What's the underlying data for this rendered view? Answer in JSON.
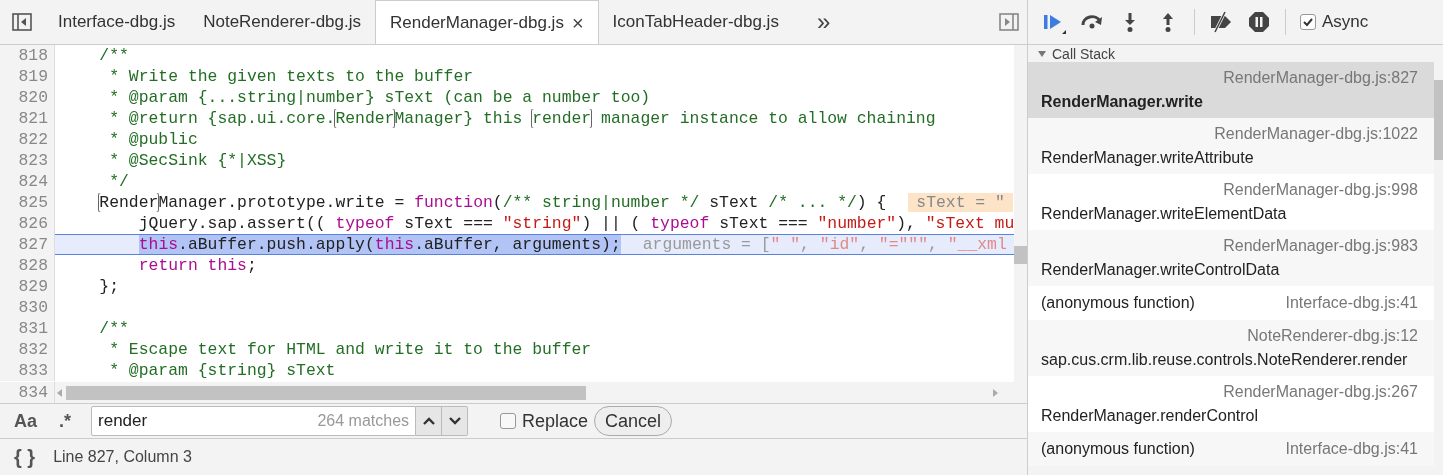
{
  "editor": {
    "tabs": [
      {
        "label": "Interface-dbg.js",
        "selected": false
      },
      {
        "label": "NoteRenderer-dbg.js",
        "selected": false
      },
      {
        "label": "RenderManager-dbg.js",
        "selected": true,
        "close_glyph": "×"
      },
      {
        "label": "IconTabHeader-dbg.js",
        "selected": false
      }
    ],
    "more_tabs_glyph": "»",
    "lines": [
      {
        "number": "818",
        "current": false,
        "tokens": [
          {
            "kind": "comment",
            "text": "    /**"
          }
        ]
      },
      {
        "number": "819",
        "current": false,
        "tokens": [
          {
            "kind": "comment",
            "text": "     * Write the given texts to the buffer"
          }
        ]
      },
      {
        "number": "820",
        "current": false,
        "tokens": [
          {
            "kind": "comment",
            "text": "     * @param {...string|number} sText (can be a number too)"
          }
        ]
      },
      {
        "number": "821",
        "current": false,
        "tokens": [
          {
            "kind": "comment",
            "text": "     * @return {sap.ui.core."
          },
          {
            "kind": "comment",
            "text": "Render",
            "match": true
          },
          {
            "kind": "comment",
            "text": "Manager} this "
          },
          {
            "kind": "comment",
            "text": "render",
            "match": true
          },
          {
            "kind": "comment",
            "text": " manager instance to allow chaining"
          }
        ]
      },
      {
        "number": "822",
        "current": false,
        "tokens": [
          {
            "kind": "comment",
            "text": "     * @public"
          }
        ]
      },
      {
        "number": "823",
        "current": false,
        "tokens": [
          {
            "kind": "comment",
            "text": "     * @SecSink {*|XSS}"
          }
        ]
      },
      {
        "number": "824",
        "current": false,
        "tokens": [
          {
            "kind": "comment",
            "text": "     */"
          }
        ]
      },
      {
        "number": "825",
        "current": false,
        "tokens": [
          {
            "kind": "plain",
            "text": "    Render",
            "match": true
          },
          {
            "kind": "plain",
            "text": "Manager.prototype.write = "
          },
          {
            "kind": "keyword",
            "text": "function"
          },
          {
            "kind": "plain",
            "text": "("
          },
          {
            "kind": "comment",
            "text": "/** string|number */"
          },
          {
            "kind": "plain",
            "text": " sText "
          },
          {
            "kind": "comment",
            "text": "/* ... */"
          },
          {
            "kind": "plain",
            "text": ") {"
          },
          {
            "kind": "value",
            "text": "sText = \""
          }
        ]
      },
      {
        "number": "826",
        "current": false,
        "tokens": [
          {
            "kind": "plain",
            "text": "        jQuery.sap.assert(( "
          },
          {
            "kind": "keyword",
            "text": "typeof"
          },
          {
            "kind": "plain",
            "text": " sText === "
          },
          {
            "kind": "string",
            "text": "\"string\""
          },
          {
            "kind": "plain",
            "text": ") || ( "
          },
          {
            "kind": "keyword",
            "text": "typeof"
          },
          {
            "kind": "plain",
            "text": " sText === "
          },
          {
            "kind": "string",
            "text": "\"number\""
          },
          {
            "kind": "plain",
            "text": "), "
          },
          {
            "kind": "string",
            "text": "\"sText mu"
          }
        ]
      },
      {
        "number": "827",
        "current": true,
        "tokens": [
          {
            "kind": "keyword",
            "text": "        this"
          },
          {
            "kind": "plain",
            "text": ".aBuffer.push.apply("
          },
          {
            "kind": "keyword",
            "text": "this"
          },
          {
            "kind": "plain",
            "text": ".aBuffer, arguments);"
          },
          {
            "kind": "hint",
            "text": "arguments = ["
          },
          {
            "kind": "hint-string",
            "text": "\" \""
          },
          {
            "kind": "hint",
            "text": ", "
          },
          {
            "kind": "hint-string",
            "text": "\"id\""
          },
          {
            "kind": "hint",
            "text": ", "
          },
          {
            "kind": "hint-string",
            "text": "\"=\"\"\""
          },
          {
            "kind": "hint",
            "text": ", "
          },
          {
            "kind": "hint-string",
            "text": "\"__xml"
          }
        ]
      },
      {
        "number": "828",
        "current": false,
        "tokens": [
          {
            "kind": "keyword",
            "text": "        return this"
          },
          {
            "kind": "plain",
            "text": ";"
          }
        ]
      },
      {
        "number": "829",
        "current": false,
        "tokens": [
          {
            "kind": "plain",
            "text": "    };"
          }
        ]
      },
      {
        "number": "830",
        "current": false
      },
      {
        "number": "831",
        "current": false,
        "tokens": [
          {
            "kind": "comment",
            "text": "    /**"
          }
        ]
      },
      {
        "number": "832",
        "current": false,
        "tokens": [
          {
            "kind": "comment",
            "text": "     * Escape text for HTML and write it to the buffer"
          }
        ]
      },
      {
        "number": "833",
        "current": false,
        "tokens": [
          {
            "kind": "comment",
            "text": "     * @param {string} sText"
          }
        ]
      },
      {
        "number": "834",
        "current": false
      }
    ],
    "find_bar": {
      "case_toggle": "Aa",
      "regex_toggle": ".*",
      "query": "render",
      "match_count": "264 matches",
      "replace": {
        "label": "Replace",
        "checked": false
      },
      "cancel": "Cancel"
    },
    "status_bar": {
      "format_button": "{ }",
      "position": "Line 827, Column 3"
    }
  },
  "debugger": {
    "async": {
      "label": "Async",
      "checked": true
    },
    "call_stack": {
      "title": "Call Stack",
      "frames": [
        {
          "kind": "stacked",
          "function": "RenderManager.write",
          "location": "RenderManager-dbg.js:827",
          "selected": true
        },
        {
          "kind": "stacked",
          "function": "RenderManager.writeAttribute",
          "location": "RenderManager-dbg.js:1022",
          "selected": false
        },
        {
          "kind": "stacked",
          "function": "RenderManager.writeElementData",
          "location": "RenderManager-dbg.js:998",
          "selected": false
        },
        {
          "kind": "stacked",
          "function": "RenderManager.writeControlData",
          "location": "RenderManager-dbg.js:983",
          "selected": false
        },
        {
          "kind": "inline",
          "function": "(anonymous function)",
          "location": "Interface-dbg.js:41",
          "selected": false
        },
        {
          "kind": "stacked",
          "function": "sap.cus.crm.lib.reuse.controls.NoteRenderer.render",
          "location": "NoteRenderer-dbg.js:12",
          "selected": false
        },
        {
          "kind": "stacked",
          "function": "RenderManager.renderControl",
          "location": "RenderManager-dbg.js:267",
          "selected": false
        },
        {
          "kind": "inline",
          "function": "(anonymous function)",
          "location": "Interface-dbg.js:41",
          "selected": false
        }
      ]
    }
  }
}
